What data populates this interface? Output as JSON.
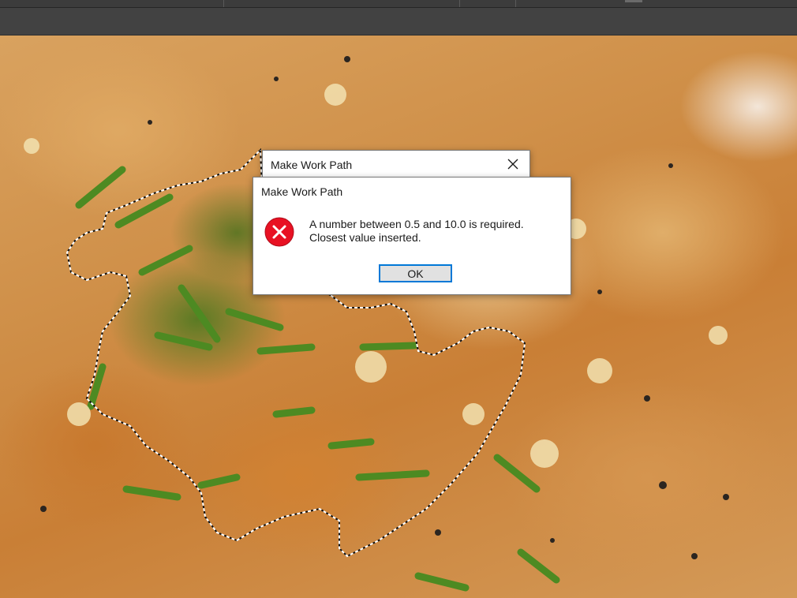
{
  "canvas": {
    "image_description_icon": "photo-canvas"
  },
  "back_dialog": {
    "title": "Make Work Path",
    "close_icon": "close-icon"
  },
  "alert_dialog": {
    "title": "Make Work Path",
    "icon": "error-icon",
    "message_line1": "A number between 0.5 and 10.0 is required.",
    "message_line2": "Closest value inserted.",
    "ok_label": "OK"
  },
  "colors": {
    "error_red": "#e81123",
    "focus_blue": "#0078d7",
    "chrome_dark": "#3c3c3c"
  }
}
